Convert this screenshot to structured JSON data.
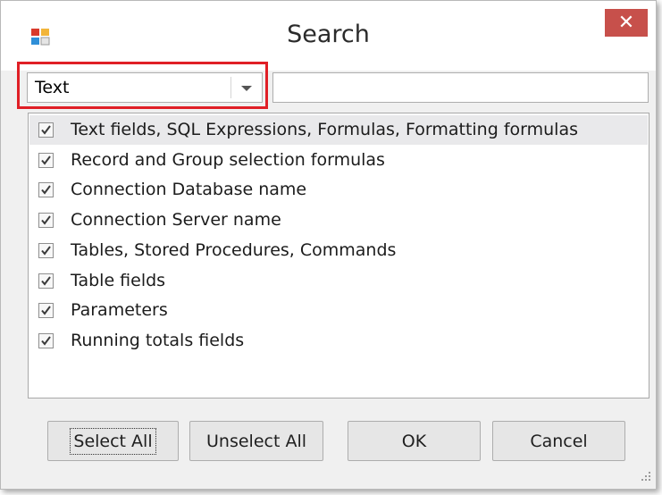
{
  "window": {
    "title": "Search",
    "close_symbol": "✕",
    "accent": "#c7504b",
    "highlight_color": "#e01f26"
  },
  "search": {
    "type_selected": "Text",
    "query_value": "",
    "query_placeholder": ""
  },
  "options": [
    {
      "label": "Text fields, SQL Expressions, Formulas, Formatting formulas",
      "checked": true
    },
    {
      "label": "Record and Group selection formulas",
      "checked": true
    },
    {
      "label": "Connection Database name",
      "checked": true
    },
    {
      "label": "Connection Server name",
      "checked": true
    },
    {
      "label": "Tables, Stored Procedures, Commands",
      "checked": true
    },
    {
      "label": "Table fields",
      "checked": true
    },
    {
      "label": "Parameters",
      "checked": true
    },
    {
      "label": "Running totals fields",
      "checked": true
    }
  ],
  "buttons": {
    "select_all": "Select All",
    "unselect_all": "Unselect All",
    "ok": "OK",
    "cancel": "Cancel"
  },
  "icons": {
    "app": "app-icon",
    "dropdown": "chevron-down-icon",
    "check": "checkmark-icon",
    "grip": "resize-grip-icon"
  }
}
